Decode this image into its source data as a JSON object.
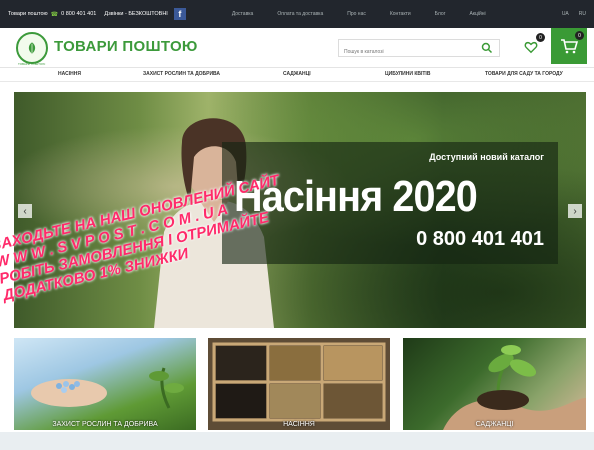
{
  "topbar": {
    "phone_label": "Товари поштою",
    "phone": "0 800 401 401",
    "free_calls": "Дзвінки - БЕЗКОШТОВНІ",
    "facebook": "f",
    "menu": [
      "Доставка",
      "Оплата та доставка",
      "Про нас",
      "Контакти",
      "Блог",
      "Акційні"
    ],
    "right": [
      "UA",
      "RU"
    ]
  },
  "header": {
    "logo_text": "ТОВАРИ ПОШТОЮ",
    "logo_sub": "ТОВАРИ ПОШТОЮ",
    "search_placeholder": "Пошук в каталозі",
    "wishlist_count": "0",
    "cart_count": "0"
  },
  "nav": [
    "НАСІННЯ",
    "ЗАХИСТ РОСЛИН ТА ДОБРИВА",
    "САДЖАНЦІ",
    "ЦИБУЛИНИ КВІТІВ",
    "ТОВАРИ ДЛЯ САДУ ТА ГОРОДУ"
  ],
  "hero": {
    "subtitle": "Доступний новий каталог",
    "title": "Насіння 2020",
    "phone": "0 800 401 401",
    "prev": "‹",
    "next": "›"
  },
  "tiles": [
    "ЗАХИСТ РОСЛИН ТА ДОБРИВА",
    "НАСІННЯ",
    "САДЖАНЦІ"
  ],
  "promo": [
    "ЗАХОДЬТЕ НА НАШ ОНОВЛЕНИЙ САЙТ",
    "W W W . S V P O S T . C O M . U A",
    "РОБІТЬ ЗАМОВЛЕННЯ І ОТРИМАЙТЕ",
    "ДОДАТКОВО 1% ЗНИЖКИ"
  ],
  "colors": {
    "brand_green": "#3a9a35",
    "promo_pink": "#ff2a6a",
    "topbar": "#22262d"
  }
}
